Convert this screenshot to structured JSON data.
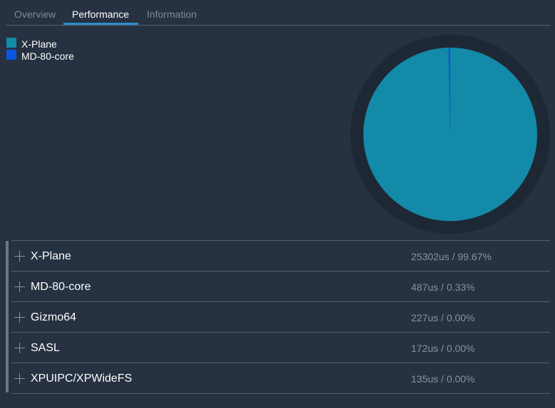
{
  "tabs": [
    {
      "label": "Overview",
      "active": false
    },
    {
      "label": "Performance",
      "active": true
    },
    {
      "label": "Information",
      "active": false
    }
  ],
  "colors": {
    "background": "#263141",
    "pie_background": "#1e2835",
    "accent_underline": "#2a8fd0",
    "series_x_plane": "#138aa8",
    "series_md80": "#0b56e0"
  },
  "legend": [
    {
      "label": "X-Plane",
      "color": "#138aa8"
    },
    {
      "label": "MD-80-core",
      "color": "#0b56e0"
    }
  ],
  "chart_data": {
    "type": "pie",
    "title": "",
    "labels": [
      "X-Plane",
      "MD-80-core"
    ],
    "values": [
      99.67,
      0.33
    ],
    "colors": [
      "#138aa8",
      "#0b56e0"
    ],
    "legend_position": "top-left"
  },
  "rows": [
    {
      "name": "X-Plane",
      "stat": "25302us / 99.67%",
      "icon": "plus-icon"
    },
    {
      "name": "MD-80-core",
      "stat": "487us / 0.33%",
      "icon": "plus-icon"
    },
    {
      "name": "Gizmo64",
      "stat": "227us / 0.00%",
      "icon": "plus-icon"
    },
    {
      "name": "SASL",
      "stat": "172us / 0.00%",
      "icon": "plus-icon"
    },
    {
      "name": "XPUIPC/XPWideFS",
      "stat": "135us / 0.00%",
      "icon": "plus-icon"
    }
  ]
}
